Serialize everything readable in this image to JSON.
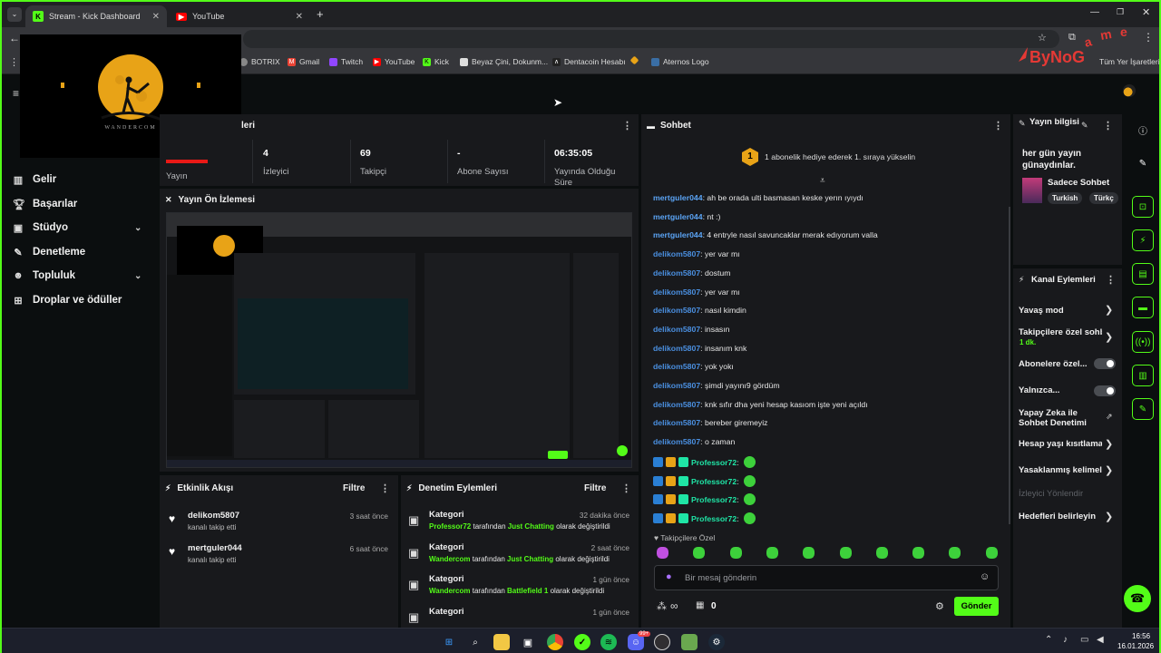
{
  "browser": {
    "tabs": [
      {
        "label": "Stream - Kick Dashboard",
        "icon": "kick-icon"
      },
      {
        "label": "YouTube",
        "icon": "youtube-icon"
      }
    ],
    "new_tab": "+",
    "bookmarks": [
      "BOTRIX",
      "Gmail",
      "Twitch",
      "YouTube",
      "Kick",
      "Beyaz Çini, Dokunm...",
      "Dentacoin Hesabı",
      "Aternos Logo"
    ],
    "bookmarks_all": "Tüm Yer İşaretleri"
  },
  "overlay": {
    "webcam_caption": "WANDERCOM",
    "brand_logo": "ByNoGame"
  },
  "sidebar": {
    "items": [
      {
        "label": "Gelir",
        "icon": "chart-icon"
      },
      {
        "label": "Başarılar",
        "icon": "trophy-icon"
      },
      {
        "label": "Stüdyo",
        "icon": "studio-icon",
        "expandable": true
      },
      {
        "label": "Denetleme",
        "icon": "wrench-icon"
      },
      {
        "label": "Topluluk",
        "icon": "users-icon",
        "expandable": true
      },
      {
        "label": "Droplar ve ödüller",
        "icon": "gift-icon"
      }
    ]
  },
  "stats": {
    "title_suffix": "leri",
    "items": [
      {
        "label": "Yayın",
        "value": ""
      },
      {
        "label": "İzleyici",
        "value": "4"
      },
      {
        "label": "Takipçi",
        "value": "69"
      },
      {
        "label": "Abone Sayısı",
        "value": "-"
      },
      {
        "label": "Yayında Olduğu Süre",
        "value": "06:35:05"
      }
    ]
  },
  "preview": {
    "title": "Yayın Ön İzlemesi"
  },
  "activity": {
    "title": "Etkinlik Akışı",
    "filter": "Filtre",
    "rows": [
      {
        "name": "delikom5807",
        "sub": "kanalı takip etti",
        "time": "3 saat önce"
      },
      {
        "name": "mertguler044",
        "sub": "kanalı takip etti",
        "time": "6 saat önce"
      }
    ]
  },
  "moderation": {
    "title": "Denetim Eylemleri",
    "filter": "Filtre",
    "rows": [
      {
        "title": "Kategori",
        "time": "32 dakika önce",
        "actor": "Professor72",
        "mid": "tarafından",
        "target": "Just Chatting",
        "end": "olarak değiştirildi"
      },
      {
        "title": "Kategori",
        "time": "2 saat önce",
        "actor": "Wandercom",
        "mid": "tarafından",
        "target": "Just Chatting",
        "end": "olarak değiştirildi"
      },
      {
        "title": "Kategori",
        "time": "1 gün önce",
        "actor": "Wandercom",
        "mid": "tarafından",
        "target": "Battlefield 1",
        "end": "olarak değiştirildi"
      },
      {
        "title": "Kategori",
        "time": "1 gün önce",
        "actor": "",
        "mid": "",
        "target": "",
        "end": ""
      }
    ]
  },
  "chat": {
    "title": "Sohbet",
    "goal_number": "1",
    "goal_text": "1 abonelik hediye ederek 1. sıraya yükselin",
    "messages": [
      {
        "user": "mertguler044",
        "text": "ah be orada ulti basmasan keske yerın ıyıydı",
        "style": "u1"
      },
      {
        "user": "mertguler044",
        "text": "nt :)",
        "style": "u1"
      },
      {
        "user": "mertguler044",
        "text": "4 entryle nasıl savuncaklar merak edıyorum valla",
        "style": "u1"
      },
      {
        "user": "delikom5807",
        "text": "yer var mı",
        "style": "u2"
      },
      {
        "user": "delikom5807",
        "text": "dostum",
        "style": "u2"
      },
      {
        "user": "delikom5807",
        "text": "yer var mı",
        "style": "u2"
      },
      {
        "user": "delikom5807",
        "text": "nasıl kimdin",
        "style": "u2"
      },
      {
        "user": "delikom5807",
        "text": "insasın",
        "style": "u2"
      },
      {
        "user": "delikom5807",
        "text": "insanım knk",
        "style": "u2"
      },
      {
        "user": "delikom5807",
        "text": "yok yokı",
        "style": "u2"
      },
      {
        "user": "delikom5807",
        "text": "şimdi yayını9 gördüm",
        "style": "u2"
      },
      {
        "user": "delikom5807",
        "text": "knk sıfır dha yeni hesap kasıom işte yeni açıldı",
        "style": "u2"
      },
      {
        "user": "delikom5807",
        "text": "bereber giremeyiz",
        "style": "u2"
      },
      {
        "user": "delikom5807",
        "text": "o zaman",
        "style": "u2"
      },
      {
        "user": "Professor72",
        "text": "",
        "style": "u3"
      },
      {
        "user": "Professor72",
        "text": "",
        "style": "u3"
      },
      {
        "user": "Professor72",
        "text": "",
        "style": "u3"
      },
      {
        "user": "Professor72",
        "text": "",
        "style": "u3"
      }
    ],
    "emote_section": "Takipçilere Özel",
    "input_placeholder": "Bir mesaj gönderin",
    "infinity": "∞",
    "points": "0",
    "send": "Gönder"
  },
  "stream_info": {
    "title": "Yayın bilgisi",
    "stream_title": "her gün yayın günaydınlar.",
    "category": "Sadece Sohbet",
    "tags": [
      "Turkish",
      "Türkç"
    ]
  },
  "channel_actions": {
    "title": "Kanal Eylemleri",
    "items": [
      {
        "label": "Yavaş mod",
        "control": "arrow"
      },
      {
        "label": "Takipçilere özel sohb",
        "sub": "1 dk.",
        "control": "arrow"
      },
      {
        "label": "Abonelere özel...",
        "control": "toggle"
      },
      {
        "label": "Yalnızca...",
        "control": "toggle"
      },
      {
        "label": "Yapay Zeka ile Sohbet Denetimi",
        "control": "external"
      },
      {
        "label": "Hesap yaşı kısıtlama",
        "control": "arrow"
      },
      {
        "label": "Yasaklanmış kelimel",
        "control": "arrow"
      },
      {
        "label": "İzleyici Yönlendir",
        "control": "none",
        "disabled": true
      },
      {
        "label": "Hedefleri belirleyin",
        "control": "arrow"
      }
    ]
  },
  "taskbar": {
    "time": "16:56",
    "date": "16.01.2026",
    "notification_count": "99+"
  },
  "colors": {
    "accent": "#53fc18",
    "panel": "#18191c",
    "background": "#0b0e0f"
  }
}
